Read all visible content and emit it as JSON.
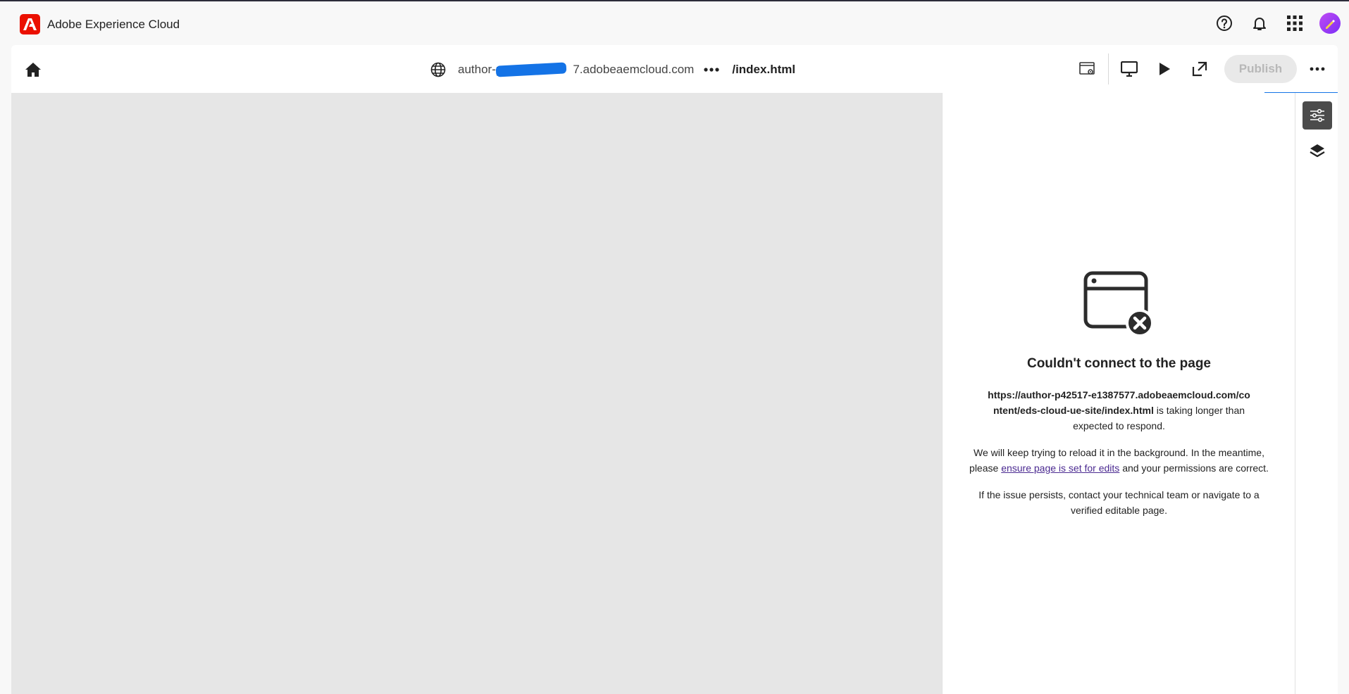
{
  "shell": {
    "brand_name": "Adobe Experience Cloud",
    "icons": [
      "help-icon",
      "bell-icon",
      "apps-grid-icon",
      "user-avatar"
    ]
  },
  "toolbar": {
    "host": "author-p42517-e1387577.adobeaemcloud.com",
    "host_prefix": "author-p",
    "host_suffix": "7.adobeaemcloud.com",
    "path": "/index.html",
    "publish_label": "Publish",
    "icons": [
      "home-icon",
      "globe-icon",
      "more-horizontal-icon",
      "page-settings-icon",
      "desktop-preview-icon",
      "play-icon",
      "open-external-icon",
      "more-horizontal-icon"
    ]
  },
  "panel": {
    "title": "Couldn't connect to the page",
    "url": "https://author-p42517-e1387577.adobeaemcloud.com/content/eds-cloud-ue-site/index.html",
    "msg1_suffix": "is taking longer than expected to respond.",
    "msg2_pre": "We will keep trying to reload it in the background. In the meantime, please",
    "msg2_link": "ensure page is set for edits",
    "msg2_post": "and your permissions are correct.",
    "msg3": "If the issue persists, contact your technical team or navigate to a verified editable page."
  },
  "rail": {
    "items": [
      "properties-icon",
      "layers-icon"
    ]
  },
  "colors": {
    "adobe_red": "#eb1000",
    "progress_blue": "#1473e6",
    "link": "#4b2a91",
    "canvas_bg": "#e6e6e6"
  }
}
